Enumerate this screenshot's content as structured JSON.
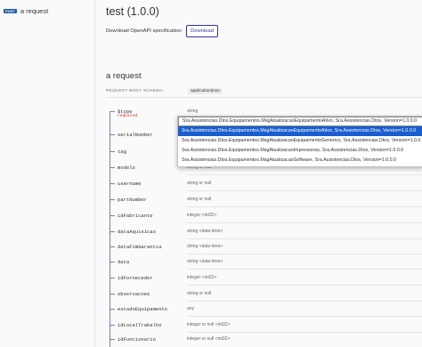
{
  "sidebar": {
    "items": [
      {
        "method": "POST",
        "label": "a request"
      }
    ]
  },
  "header": {
    "title": "test (1.0.0)",
    "download_text": "Download OpenAPI specification:",
    "download_button": "Download"
  },
  "operation": {
    "title": "a request",
    "schema_label": "REQUEST BODY SCHEMA:",
    "content_type": "application/json"
  },
  "properties": [
    {
      "name": "$type",
      "type": "string",
      "required": "required"
    },
    {
      "name": "serialNumber",
      "type": ""
    },
    {
      "name": "tag",
      "type": ""
    },
    {
      "name": "modelo",
      "type": "string or null"
    },
    {
      "name": "username",
      "type": "string or null"
    },
    {
      "name": "partNumber",
      "type": "string or null"
    },
    {
      "name": "idFabricante",
      "type": "integer <int32>"
    },
    {
      "name": "dataAquisicao",
      "type": "string <date-time>"
    },
    {
      "name": "dataFimGarantia",
      "type": "string <date-time>"
    },
    {
      "name": "data",
      "type": "string <date-time>"
    },
    {
      "name": "idFornecedor",
      "type": "integer <int32>"
    },
    {
      "name": "observacoes",
      "type": "string or null"
    },
    {
      "name": "estadoEquipamento",
      "type": "any"
    },
    {
      "name": "idLocalTrabalho",
      "type": "integer or null <int32>"
    },
    {
      "name": "idFuncionario",
      "type": "integer or null <int32>"
    }
  ],
  "oneof_options": [
    "Sra.Assistencias.Dtos.Equipamentos.MsgAtualizacaoEquipamentoAtivo, Sra.Assistencias.Dtos, Version=1.0.0.0",
    "Sra.Assistencias.Dtos.Equipamentos.MsgAtualizacaoEquipamentoAtivo, Sra.Assistencias.Dtos, Version=1.0.0.0",
    "Sra.Assistencias.Dtos.Equipamentos.MsgAtualizacaoEquipamentoGenerico, Sra.Assistencias.Dtos, Version=1.0.0.0",
    "Sra.Assistencias.Dtos.Equipamentos.MsgAtualizacaoImpressoras, Sra.Assistencias.Dtos, Version=1.0.0.0",
    "Sra.Assistencias.Dtos.Equipamentos.MsgAtualizacaoSoftware, Sra.Assistencias.Dtos, Version=1.0.0.0"
  ],
  "colors": {
    "accent": "#32329f",
    "post_badge": "#1f5aa6",
    "required": "#d41f1c",
    "selected_option": "#1a5ecf"
  }
}
